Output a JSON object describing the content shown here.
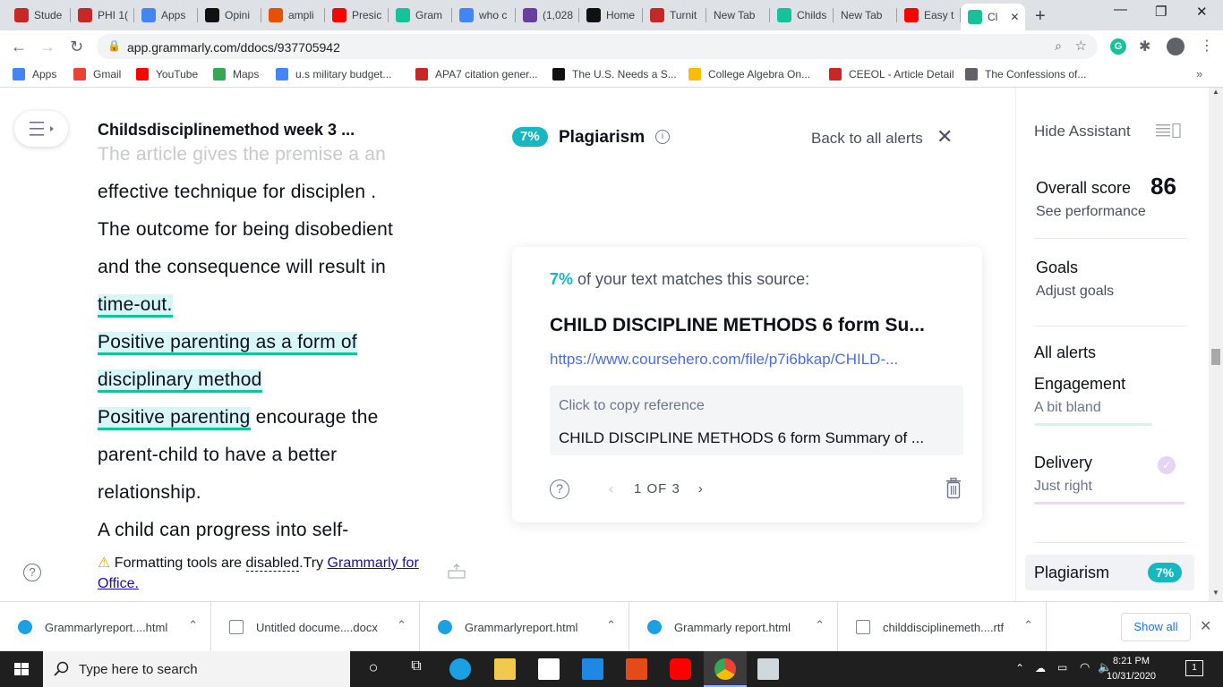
{
  "browser": {
    "tabs": [
      {
        "label": "Stude",
        "color": "#c62828"
      },
      {
        "label": "PHI 1(",
        "color": "#c62828"
      },
      {
        "label": "Apps",
        "color": "#4285f4"
      },
      {
        "label": "Opini",
        "color": "#111111"
      },
      {
        "label": "ampli",
        "color": "#e65100"
      },
      {
        "label": "Presic",
        "color": "#ff0000"
      },
      {
        "label": "Gram",
        "color": "#15c39a"
      },
      {
        "label": "who c",
        "color": "#4285f4"
      },
      {
        "label": "(1,028",
        "color": "#6b3fa0"
      },
      {
        "label": "Home",
        "color": "#111111"
      },
      {
        "label": "Turnit",
        "color": "#c62828"
      },
      {
        "label": "New Tab",
        "color": ""
      },
      {
        "label": "Childs",
        "color": "#15c39a"
      },
      {
        "label": "New Tab",
        "color": ""
      },
      {
        "label": "Easy t",
        "color": "#ff0000"
      },
      {
        "label": "Cl",
        "color": "#15c39a"
      }
    ],
    "url": "app.grammarly.com/ddocs/937705942",
    "bookmarks": [
      {
        "label": "Apps",
        "color": "#4285f4"
      },
      {
        "label": "Gmail",
        "color": "#ea4335"
      },
      {
        "label": "YouTube",
        "color": "#ff0000"
      },
      {
        "label": "Maps",
        "color": "#34a853"
      },
      {
        "label": "u.s military budget...",
        "color": "#4285f4"
      },
      {
        "label": "APA7 citation gener...",
        "color": "#c62828"
      },
      {
        "label": "The U.S. Needs a S...",
        "color": "#111111"
      },
      {
        "label": "College Algebra On...",
        "color": "#fbbc05"
      },
      {
        "label": "CEEOL - Article Detail",
        "color": "#c62828"
      },
      {
        "label": "The Confessions of...",
        "color": "#5f6368"
      }
    ]
  },
  "editor": {
    "title": "Childsdisciplinemethod week 3 ...",
    "lines": [
      {
        "text": "The article gives the premise a an",
        "style": "fade"
      },
      {
        "text": "effective technique for disciplen .",
        "style": ""
      },
      {
        "text": "The outcome for being disobedient",
        "style": ""
      },
      {
        "text": "and the  consequence will result in",
        "style": ""
      },
      {
        "text": "time-out.",
        "style": "hl"
      },
      {
        "text": "Positive parenting as a form of ",
        "style": "hl"
      },
      {
        "text": "disciplinary method",
        "style": "hl"
      },
      {
        "text": "Positive parenting",
        "style": "hl",
        "rest": " encourage the"
      },
      {
        "text": "parent-child  to have a better",
        "style": ""
      },
      {
        "text": "relationship.",
        "style": ""
      },
      {
        "text": "A child can progress into  self-",
        "style": ""
      }
    ],
    "notice_prefix": "Formatting tools are ",
    "notice_disabled": "disabled",
    "notice_try": ".Try ",
    "notice_link": "Grammarly for Office."
  },
  "plagiarism": {
    "badge": "7%",
    "title": "Plagiarism",
    "back_label": "Back to all alerts",
    "match_pct": "7%",
    "match_text": " of your text matches this source:",
    "source_title": "CHILD DISCIPLINE METHODS 6 form Su...",
    "source_url": "https://www.coursehero.com/file/p7i6bkap/CHILD-...",
    "copy_label": "Click to copy reference",
    "copy_ref": "CHILD DISCIPLINE METHODS 6 form Summary of ...",
    "pager": "1 OF 3"
  },
  "assistant": {
    "hide_label": "Hide Assistant",
    "overall_label": "Overall score",
    "overall_score": "86",
    "see_performance": "See performance",
    "goals": "Goals",
    "adjust_goals": "Adjust goals",
    "all_alerts": "All alerts",
    "engagement": "Engagement",
    "engagement_sub": "A bit bland",
    "delivery": "Delivery",
    "delivery_sub": "Just right",
    "plagiarism": "Plagiarism",
    "plagiarism_badge": "7%"
  },
  "downloads": [
    {
      "name": "Grammarlyreport....html",
      "icon": "edge-icon"
    },
    {
      "name": "Untitled docume....docx",
      "icon": "doc-icon"
    },
    {
      "name": "Grammarlyreport.html",
      "icon": "edge-icon"
    },
    {
      "name": "Grammarly report.html",
      "icon": "edge-icon"
    },
    {
      "name": "childdisciplinemeth....rtf",
      "icon": "doc-icon"
    }
  ],
  "downloads_show_all": "Show all",
  "taskbar": {
    "search_placeholder": "Type here to search",
    "time": "8:21 PM",
    "date": "10/31/2020"
  }
}
